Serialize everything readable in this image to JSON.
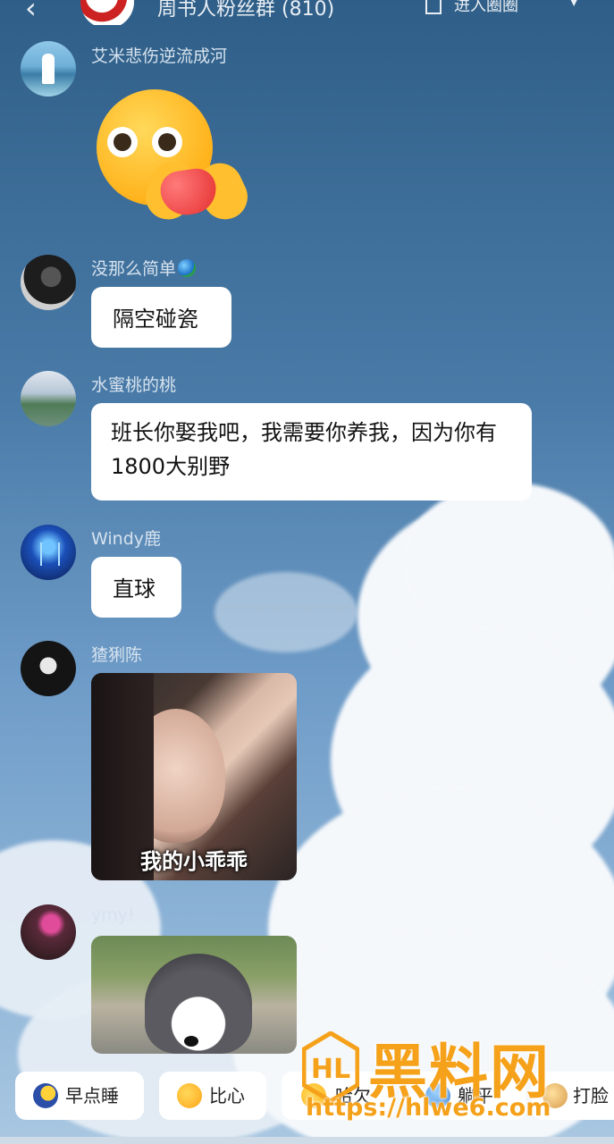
{
  "header": {
    "back_icon": "chevron-left",
    "group_title": "周书人粉丝群 (810)",
    "circle_link": "进入圈圈",
    "more_icon": "chevron-down"
  },
  "messages": [
    {
      "sender": "艾米悲伤逆流成河",
      "type": "sticker",
      "sticker": "hug-heart-emoji"
    },
    {
      "sender": "没那么简单",
      "sender_emoji": "globe",
      "type": "text",
      "text": "隔空碰瓷"
    },
    {
      "sender": "水蜜桃的桃",
      "type": "text",
      "text": "班长你娶我吧，我需要你养我，因为你有1800大别野"
    },
    {
      "sender": "Windy鹿",
      "type": "text",
      "text": "直球"
    },
    {
      "sender": "猹猁陈",
      "type": "image",
      "caption": "我的小乖乖"
    },
    {
      "sender": "ymy!",
      "type": "image",
      "caption": ""
    }
  ],
  "quick_replies": [
    {
      "label": "早点睡",
      "icon": "moon-emoji"
    },
    {
      "label": "比心",
      "icon": "heart-hands-emoji"
    },
    {
      "label": "哈欠",
      "icon": "yawn-emoji"
    },
    {
      "label": "躺平",
      "icon": "lie-flat-emoji"
    },
    {
      "label": "打脸",
      "icon": "slap-emoji"
    }
  ],
  "watermark": {
    "title": "黑料网",
    "url": "https://hlwe6.com"
  },
  "colors": {
    "bubble": "#ffffff",
    "sky_top": "#2f5f88",
    "watermark": "#f5a11a"
  }
}
